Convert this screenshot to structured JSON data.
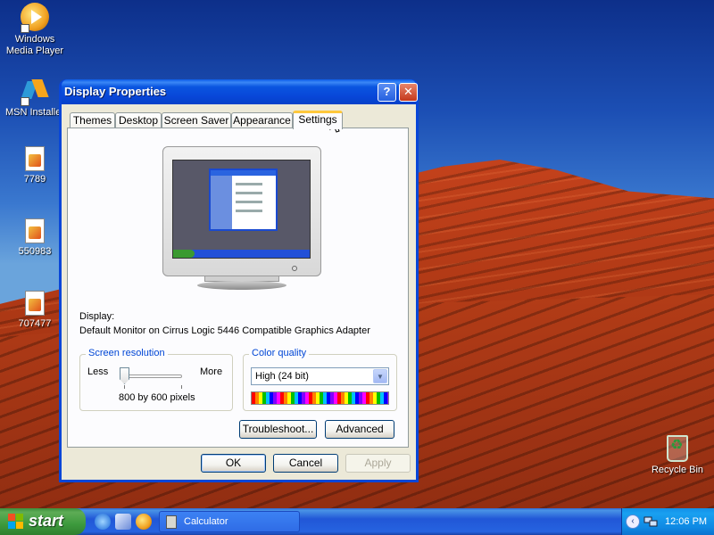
{
  "desktop": {
    "icons": [
      {
        "label": "Windows Media Player",
        "icon": "windows-media-player-icon"
      },
      {
        "label": "MSN Installer",
        "icon": "msn-butterfly-icon"
      },
      {
        "label": "7789",
        "icon": "image-file-icon"
      },
      {
        "label": "550983",
        "icon": "image-file-icon"
      },
      {
        "label": "707477",
        "icon": "image-file-icon"
      },
      {
        "label": "Recycle Bin",
        "icon": "recycle-bin-icon"
      }
    ]
  },
  "window": {
    "title": "Display Properties",
    "help_glyph": "?",
    "close_glyph": "✕",
    "tabs": [
      "Themes",
      "Desktop",
      "Screen Saver",
      "Appearance",
      "Settings"
    ],
    "active_tab": "Settings",
    "display_label": "Display:",
    "display_value": "Default Monitor on Cirrus Logic 5446 Compatible Graphics Adapter",
    "resolution": {
      "legend": "Screen resolution",
      "less": "Less",
      "more": "More",
      "value": "800 by 600 pixels",
      "slider_level": 0
    },
    "color_quality": {
      "legend": "Color quality",
      "selected": "High (24 bit)"
    },
    "buttons": {
      "troubleshoot": "Troubleshoot...",
      "advanced": "Advanced",
      "ok": "OK",
      "cancel": "Cancel",
      "apply": "Apply"
    }
  },
  "taskbar": {
    "start_label": "start",
    "task": "Calculator",
    "clock": "12:06 PM",
    "tray_chevron": "‹"
  },
  "colors": {
    "titlebar": "#0846d8",
    "start_button": "#3d9a3d",
    "taskbar": "#2157d7",
    "dialog_face": "#ece9d8",
    "active_tab_accent": "#ffc83c",
    "groupbox_legend": "#0046d5"
  }
}
